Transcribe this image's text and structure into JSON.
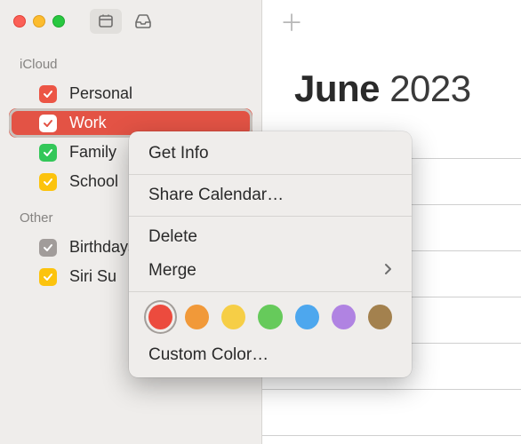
{
  "sidebar": {
    "sections": [
      {
        "title": "iCloud",
        "items": [
          {
            "label": "Personal",
            "color": "#ec5545",
            "selected": false
          },
          {
            "label": "Work",
            "color": "#ffffff",
            "bg": "#e35345",
            "selected": true
          },
          {
            "label": "Family",
            "color": "#33c759",
            "selected": false
          },
          {
            "label": "School",
            "color": "#fcc30d",
            "selected": false
          }
        ]
      },
      {
        "title": "Other",
        "items": [
          {
            "label": "Birthdays",
            "color": "#a19c9a",
            "selected": false
          },
          {
            "label": "Siri Suggestions",
            "color": "#fcc30d",
            "selected": false,
            "truncated": "Siri Su"
          }
        ]
      }
    ]
  },
  "main": {
    "month": "June",
    "year": "2023"
  },
  "context_menu": {
    "items": [
      {
        "label": "Get Info"
      },
      {
        "label": "Share Calendar…"
      },
      {
        "label": "Delete"
      },
      {
        "label": "Merge",
        "submenu": true
      }
    ],
    "colors": [
      {
        "hex": "#ec4b3e",
        "selected": true
      },
      {
        "hex": "#f19939"
      },
      {
        "hex": "#f6ce46"
      },
      {
        "hex": "#66ca5b"
      },
      {
        "hex": "#4da7ee"
      },
      {
        "hex": "#b083e2"
      },
      {
        "hex": "#a3814e"
      }
    ],
    "custom_label": "Custom Color…"
  }
}
